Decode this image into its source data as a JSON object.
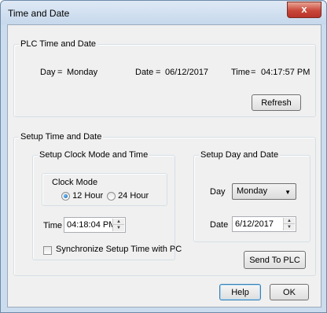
{
  "window": {
    "title": "Time and Date",
    "close_glyph": "x"
  },
  "plc": {
    "group_title": "PLC Time and Date",
    "day_label": "Day",
    "day_eq": "=",
    "day_value": "Monday",
    "date_label": "Date",
    "date_eq": "=",
    "date_value": "06/12/2017",
    "time_label": "Time",
    "time_eq": "=",
    "time_value": "04:17:57 PM",
    "refresh_label": "Refresh"
  },
  "setup": {
    "group_title": "Setup Time and Date",
    "clock": {
      "group_title": "Setup Clock Mode and Time",
      "mode_title": "Clock Mode",
      "option_12": "12 Hour",
      "option_24": "24 Hour",
      "selected": "12 Hour",
      "time_label": "Time",
      "time_value": "04:18:04 PM",
      "sync_label": "Synchronize Setup Time with PC",
      "sync_checked": false
    },
    "day_date": {
      "group_title": "Setup Day and Date",
      "day_label": "Day",
      "day_value": "Monday",
      "date_label": "Date",
      "date_value": "6/12/2017"
    },
    "send_label": "Send To PLC"
  },
  "footer": {
    "help_label": "Help",
    "ok_label": "OK"
  },
  "icons": {
    "close": "close-icon",
    "dropdown": "chevron-down-icon",
    "spin_up": "spin-up-icon",
    "spin_down": "spin-down-icon"
  }
}
